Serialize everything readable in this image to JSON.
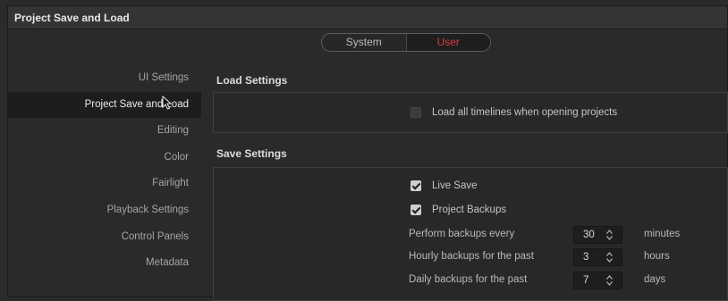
{
  "window": {
    "title": "Project Save and Load"
  },
  "toggle": {
    "system": "System",
    "user": "User",
    "selected": "User",
    "accent": "#d73c3c"
  },
  "sidebar": {
    "items": [
      {
        "label": "UI Settings"
      },
      {
        "label": "Project Save and Load",
        "active": true
      },
      {
        "label": "Editing"
      },
      {
        "label": "Color"
      },
      {
        "label": "Fairlight"
      },
      {
        "label": "Playback Settings"
      },
      {
        "label": "Control Panels"
      },
      {
        "label": "Metadata"
      }
    ]
  },
  "load_settings": {
    "title": "Load Settings",
    "load_all_timelines": {
      "label": "Load all timelines when opening projects",
      "checked": false
    }
  },
  "save_settings": {
    "title": "Save Settings",
    "live_save": {
      "label": "Live Save",
      "checked": true
    },
    "project_backups": {
      "label": "Project Backups",
      "checked": true
    },
    "perform_backups": {
      "label": "Perform backups every",
      "value": "30",
      "unit": "minutes"
    },
    "hourly_backups": {
      "label": "Hourly backups for the past",
      "value": "3",
      "unit": "hours"
    },
    "daily_backups": {
      "label": "Daily backups for the past",
      "value": "7",
      "unit": "days"
    }
  }
}
